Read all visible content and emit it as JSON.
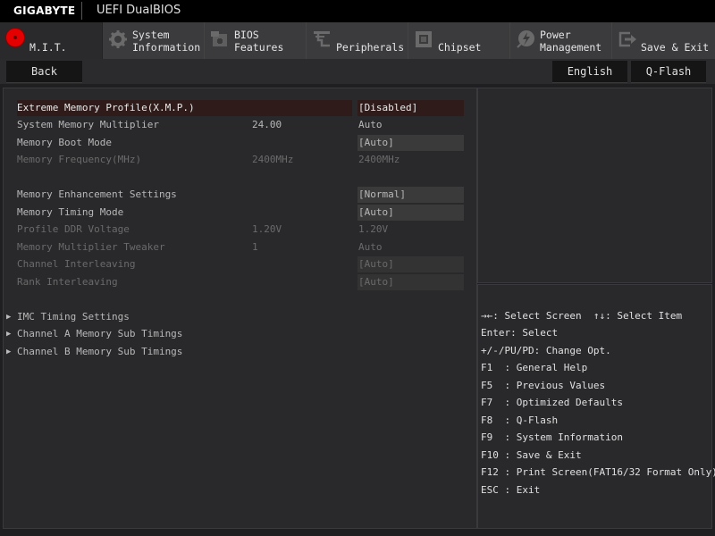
{
  "header": {
    "brand": "GIGABYTE",
    "product": "UEFI DualBIOS"
  },
  "tabs": [
    {
      "label": "M.I.T.",
      "icon": "mit-red-dot-icon",
      "active": true
    },
    {
      "label": "System\nInformation",
      "icon": "gear-icon"
    },
    {
      "label": "BIOS\nFeatures",
      "icon": "bios-chip-icon"
    },
    {
      "label": "Peripherals",
      "icon": "peripherals-icon"
    },
    {
      "label": "Chipset",
      "icon": "chipset-icon"
    },
    {
      "label": "Power\nManagement",
      "icon": "power-icon"
    },
    {
      "label": "Save & Exit",
      "icon": "exit-icon"
    }
  ],
  "toolbar": {
    "back": "Back",
    "language": "English",
    "qflash": "Q-Flash"
  },
  "settings": [
    {
      "name": "Extreme Memory Profile(X.M.P.)",
      "current": "",
      "value": "[Disabled]",
      "state": "selected"
    },
    {
      "name": "System Memory Multiplier",
      "current": "24.00",
      "value": "Auto",
      "state": "normal"
    },
    {
      "name": "Memory Boot Mode",
      "current": "",
      "value": "[Auto]",
      "state": "normal"
    },
    {
      "name": "Memory Frequency(MHz)",
      "current": "2400MHz",
      "value": "2400MHz",
      "state": "dim"
    },
    {
      "name": "Memory Enhancement Settings",
      "current": "",
      "value": "[Normal]",
      "state": "white"
    },
    {
      "name": "Memory Timing Mode",
      "current": "",
      "value": "[Auto]",
      "state": "white"
    },
    {
      "name": "Profile DDR Voltage",
      "current": "1.20V",
      "value": "1.20V",
      "state": "dim"
    },
    {
      "name": "Memory Multiplier Tweaker",
      "current": "1",
      "value": "Auto",
      "state": "dim"
    },
    {
      "name": "Channel Interleaving",
      "current": "",
      "value": "[Auto]",
      "state": "dim"
    },
    {
      "name": "Rank Interleaving",
      "current": "",
      "value": "[Auto]",
      "state": "dim"
    }
  ],
  "submenus": [
    "IMC Timing Settings",
    "Channel A Memory Sub Timings",
    "Channel B Memory Sub Timings"
  ],
  "keyhelp": [
    "→←: Select Screen  ↑↓: Select Item",
    "Enter: Select",
    "+/-/PU/PD: Change Opt.",
    "F1  : General Help",
    "F5  : Previous Values",
    "F7  : Optimized Defaults",
    "F8  : Q-Flash",
    "F9  : System Information",
    "F10 : Save & Exit",
    "F12 : Print Screen(FAT16/32 Format Only)",
    "ESC : Exit"
  ]
}
